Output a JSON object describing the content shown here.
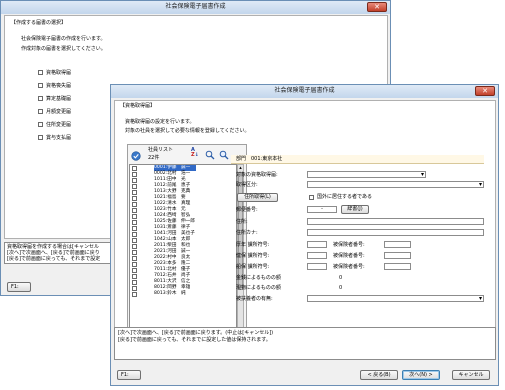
{
  "back_window": {
    "title": "社会保険電子届書作成",
    "section": "【作成する届書の選択】",
    "intro1": "社会保険電子届書の作成を行います。",
    "intro2": "作成対象の届書を選択してください。",
    "options": [
      "資格取得届",
      "資格喪失届",
      "算定基礎届",
      "月額変更届",
      "住所変更届",
      "賞与支払届"
    ],
    "msg1": "資格取得届を作成する場合は[キャンセル",
    "msg2": "[次へ]で次画面へ、[戻る]で前画面に戻り",
    "msg3": "[戻る]で前画面に戻っても、それまで設定",
    "f1": "F1:"
  },
  "front_window": {
    "title": "社会保険電子届書作成",
    "section": "【資格取得届】",
    "intro1": "資格取得届の設定を行います。",
    "intro2": "対象の社員を選択して必要な情報を登録してください。",
    "list_header": "社員リスト",
    "count": "22件",
    "employees": [
      "0001:伊藤　誠一",
      "0002:北村　浩一",
      "1011:田中　光",
      "1012:前尾　恵子",
      "1013:大野　克典",
      "1021:福島　要",
      "1022:清水　真理",
      "1023:竹本　元",
      "1024:西崎　智弘",
      "1025:佐藤　伸一郎",
      "1031:斎藤　律子",
      "1041:河田　美也子",
      "1042:山本　太郎",
      "2011:柴田　和也",
      "2021:河田　誠一",
      "2022:村中　良太",
      "2023:本多　隆二",
      "7011:北村　優子",
      "7012:石井　尚子",
      "8011:大沢　信之",
      "8012:岡野　幸雄",
      "8013:鈴木　純"
    ],
    "dept": "部門　001:東京本社",
    "form": {
      "shikaku_label": "対象の資格取得届:",
      "shutoku_kubun_label": "取得区分:",
      "address_button": "住所取得(L)",
      "abroad_label": "国外に居住する者である",
      "postal_label": "郵便番号:",
      "postal_dash": "-",
      "search_button": "辞書(J)",
      "address_label": "住所:",
      "address_kana_label": "住所カナ:",
      "kosei_label": "厚年 課所符号:",
      "kenpo_label": "健保 課所符号:",
      "kokumin_label": "船保 課所符号:",
      "hihoken1_label": "被保険者番号:",
      "hihoken2_label": "被保険者番号:",
      "hihoken3_label": "被保険者番号:",
      "kinsen_label": "金銭によるものの額",
      "genbutsu_label": "現物によるものの額",
      "kinsen_value": "0",
      "genbutsu_value": "0",
      "fuyou_label": "被扶養者の有無:"
    },
    "msg1": "[次へ]で次画面へ、[戻る]で前画面に戻ります。(中止は[キャンセル])",
    "msg2": "[戻る]で前画面に戻っても、それまでに設定した値は保持されます。",
    "f1": "F1:",
    "back_button": "< 戻る(B)",
    "next_button": "次へ(N) >",
    "cancel_button": "キャンセル"
  }
}
